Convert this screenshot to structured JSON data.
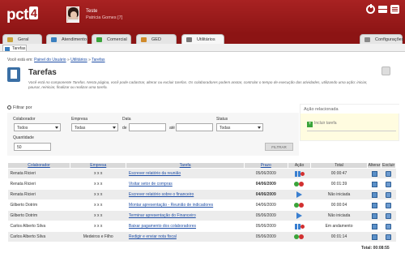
{
  "app": {
    "logo_text": "pct",
    "logo_badge": "4",
    "user": {
      "company": "Teste",
      "name": "Patricia Gomes [7]"
    },
    "header_icons": [
      "power-icon",
      "mail-icon",
      "menu-icon"
    ]
  },
  "tabs": [
    {
      "label": "Geral",
      "icon": "home-icon",
      "color": "#c9a23a"
    },
    {
      "label": "Atendimento",
      "icon": "support-icon",
      "color": "#3a7fbf"
    },
    {
      "label": "Comercial",
      "icon": "cart-icon",
      "color": "#3aa43a"
    },
    {
      "label": "GED",
      "icon": "folder-icon",
      "color": "#d08a2a"
    },
    {
      "label": "Utilitários",
      "icon": "tools-icon",
      "color": "#7a7a7a"
    }
  ],
  "config_tab": {
    "label": "Configurações",
    "icon": "gear-icon"
  },
  "subtab": {
    "label": "Tarefas"
  },
  "breadcrumb": {
    "prefix": "Você está em:",
    "items": [
      "Painel do Usuário",
      "Utilitários",
      "Tarefas"
    ],
    "separator": "»"
  },
  "page": {
    "title": "Tarefas",
    "description": "Você está no componente Tarefas. Nesta página, você pode cadastrar, alterar ou excluir tarefas. Os colaboradores podem anotar, controlar o tempo de execução das atividades, utilizando uma ação: iniciar, pausar, reiniciar, finalizar ou realizar uma tarefa."
  },
  "filter": {
    "title": "Filtrar por",
    "colaborador": {
      "label": "Colaborador",
      "value": "Todos"
    },
    "empresa": {
      "label": "Empresa",
      "value": "Todas"
    },
    "data": {
      "label": "Data",
      "de_label": "de",
      "ate_label": "até",
      "de_value": "",
      "ate_value": ""
    },
    "status": {
      "label": "Status",
      "value": "Todas"
    },
    "quantidade": {
      "label": "Quantidade",
      "value": "50"
    },
    "button_label": "FILTRAR"
  },
  "related": {
    "title": "Ação relacionada",
    "item": "Incluir tarefa"
  },
  "table": {
    "headers": [
      "Colaborador",
      "Empresa",
      "Tarefa",
      "Prazo",
      "Ação",
      "Total",
      "Alterar",
      "Excluir"
    ],
    "rows": [
      {
        "colaborador": "Renata Ricieri",
        "empresa": "x x x",
        "tarefa": "Escrever relatório da reunião",
        "prazo": "05/06/2009",
        "prazo_bold": false,
        "acao": "done",
        "total": "00:00:47"
      },
      {
        "colaborador": "Renata Ricieri",
        "empresa": "x x x",
        "tarefa": "Visitar setor de compras",
        "prazo": "04/06/2009",
        "prazo_bold": true,
        "acao": "pair",
        "total": "00:01:39"
      },
      {
        "colaborador": "Renata Ricieri",
        "empresa": "x x x",
        "tarefa": "Escrever relatório sobre o financeiro",
        "prazo": "04/06/2009",
        "prazo_bold": true,
        "acao": "play",
        "total": "Não iniciada"
      },
      {
        "colaborador": "Gilberto Dotrim",
        "empresa": "x x x",
        "tarefa": "Montar apresentação - Reunião de indicadores",
        "prazo": "04/06/2009",
        "prazo_bold": false,
        "acao": "pair",
        "total": "00:00:04"
      },
      {
        "colaborador": "Gilberto Dotrim",
        "empresa": "x x x",
        "tarefa": "Terminar apresentação do Financeiro",
        "prazo": "05/06/2009",
        "prazo_bold": false,
        "acao": "play",
        "total": "Não iniciada"
      },
      {
        "colaborador": "Carlos Alberto Silva",
        "empresa": "x x x",
        "tarefa": "Baixar pagamento dos colaboradores",
        "prazo": "05/06/2009",
        "prazo_bold": false,
        "acao": "done",
        "total": "Em andamento"
      },
      {
        "colaborador": "Carlos Alberto Silva",
        "empresa": "Medeiros e Filho",
        "tarefa": "Redigir e enviar nota fiscal",
        "prazo": "05/06/2009",
        "prazo_bold": false,
        "acao": "pair",
        "total": "00:01:14"
      }
    ],
    "total_label": "Total: 00:08:55"
  }
}
